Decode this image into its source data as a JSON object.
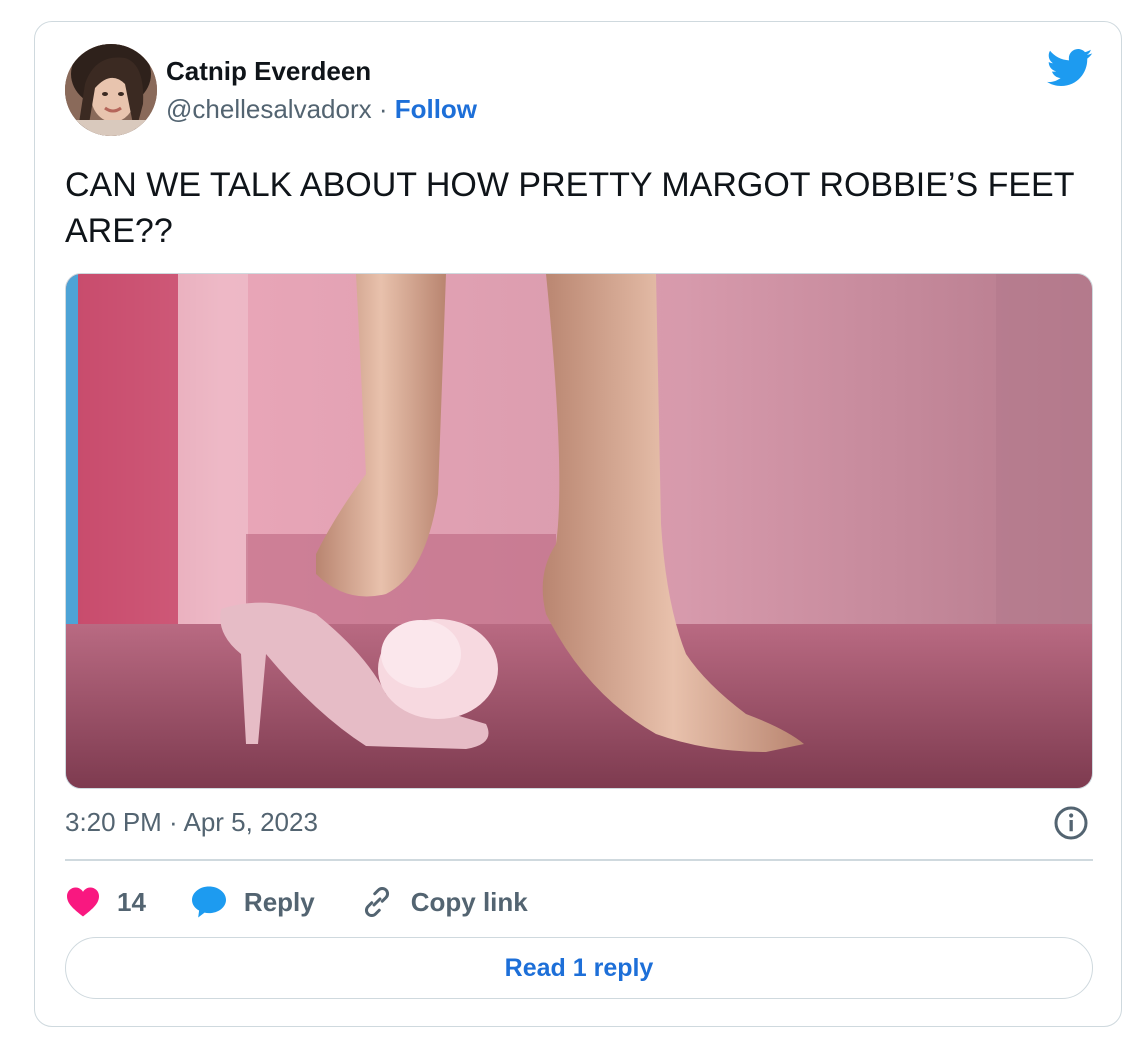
{
  "author": {
    "display_name": "Catnip Everdeen",
    "handle": "@chellesalvadorx",
    "separator": " · ",
    "follow_label": "Follow"
  },
  "tweet": {
    "text": "CAN WE TALK ABOUT HOW PRETTY MARGOT ROBBIE’S FEET ARE??",
    "timestamp": "3:20 PM · Apr 5, 2023"
  },
  "actions": {
    "like_count": "14",
    "reply_label": "Reply",
    "copy_link_label": "Copy link"
  },
  "read_replies_label": "Read 1 reply",
  "icons": {
    "brand": "twitter-bird-icon",
    "like": "heart-icon",
    "reply": "speech-bubble-icon",
    "copy": "link-icon",
    "info": "info-icon"
  },
  "colors": {
    "twitter_blue": "#1d9bf0",
    "link_blue": "#1d6fd8",
    "heart_pink": "#f91880",
    "secondary_text": "#536471",
    "border": "#cfd9de"
  }
}
